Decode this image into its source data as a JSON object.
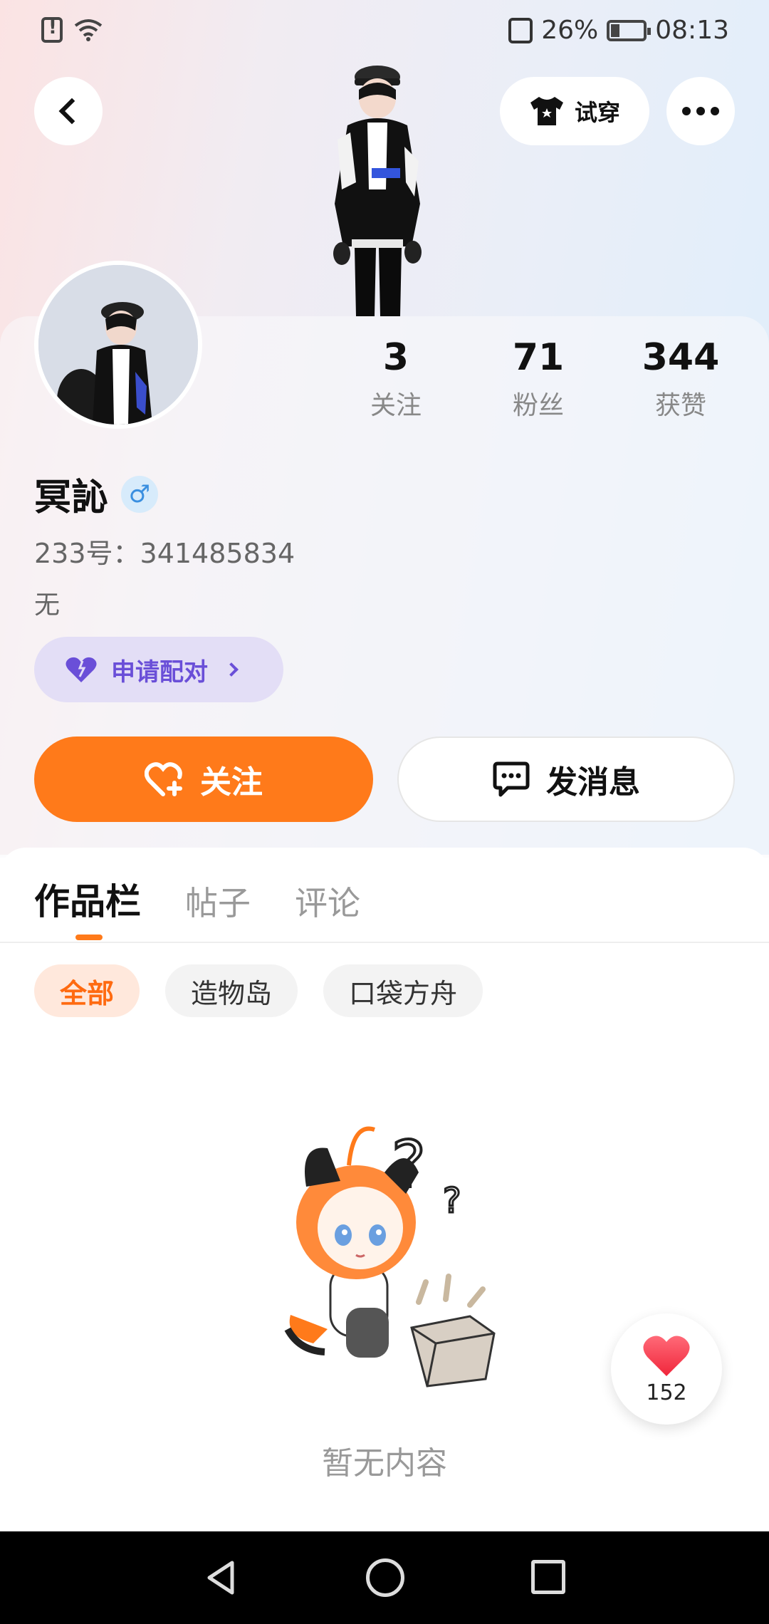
{
  "status_bar": {
    "battery": "26%",
    "time": "08:13"
  },
  "header": {
    "tryon_label": "试穿"
  },
  "profile": {
    "name": "冥訫",
    "gender_symbol": "♂",
    "uid": "233号：341485834",
    "bio": "无",
    "pair_label": "申请配对"
  },
  "stats": [
    {
      "value": "3",
      "label": "关注"
    },
    {
      "value": "71",
      "label": "粉丝"
    },
    {
      "value": "344",
      "label": "获赞"
    }
  ],
  "actions": {
    "follow_label": "关注",
    "message_label": "发消息"
  },
  "tabs": [
    {
      "label": "作品栏",
      "active": true
    },
    {
      "label": "帖子",
      "active": false
    },
    {
      "label": "评论",
      "active": false
    }
  ],
  "filters": [
    {
      "label": "全部",
      "active": true
    },
    {
      "label": "造物岛",
      "active": false
    },
    {
      "label": "口袋方舟",
      "active": false
    }
  ],
  "empty_text": "暂无内容",
  "like_fab": {
    "count": "152"
  },
  "colors": {
    "accent": "#ff7a1a",
    "pair": "#6a4fd8"
  }
}
